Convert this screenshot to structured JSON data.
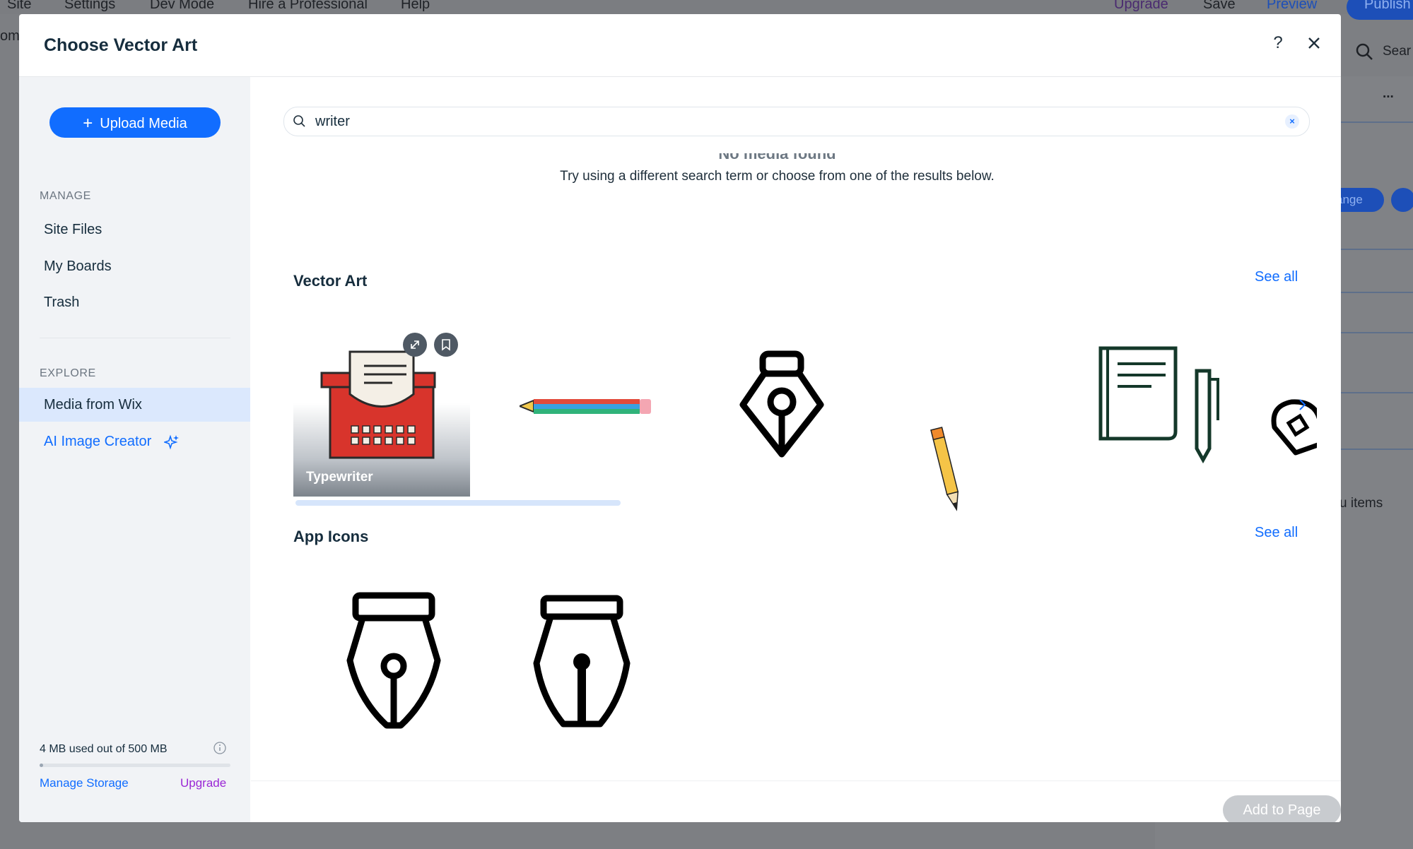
{
  "editor": {
    "menu": [
      "Site",
      "Settings",
      "Dev Mode",
      "Hire a Professional",
      "Help"
    ],
    "upgrade": "Upgrade",
    "save": "Save",
    "preview": "Preview",
    "publish": "Publish",
    "search_label": "Sear",
    "left_fragment": "om",
    "more": "...",
    "pill_fragment": "ange",
    "items_fragment": "u items"
  },
  "dialog": {
    "title": "Choose Vector Art",
    "help_label": "?",
    "add_to_page": "Add to Page"
  },
  "sidebar": {
    "upload_plus": "+",
    "upload_label": "Upload Media",
    "manage_heading": "MANAGE",
    "manage_items": [
      "Site Files",
      "My Boards",
      "Trash"
    ],
    "explore_heading": "EXPLORE",
    "explore_items": [
      "Media from Wix",
      "AI Image Creator"
    ],
    "active_item": "Media from Wix",
    "storage_text": "4 MB used out of 500 MB",
    "storage_used_fraction": 0.008,
    "manage_storage": "Manage Storage",
    "upgrade": "Upgrade"
  },
  "search": {
    "value": "writer",
    "placeholder": "",
    "clear_label": "×"
  },
  "results": {
    "no_results_partial": "No media found",
    "hint": "Try using a different search term or choose from one of the results below.",
    "sections": [
      {
        "title": "Vector Art",
        "see_all": "See all",
        "items": [
          "typewriter-icon",
          "crayon-icon",
          "pen-nib-icon",
          "pencil-icon",
          "notebook-pen-icon",
          "pen-tool-icon"
        ],
        "hovered_item_label": "Typewriter"
      },
      {
        "title": "App Icons",
        "see_all": "See all",
        "items": [
          "fountain-pen-nib-icon",
          "fountain-pen-nib-alt-icon"
        ]
      }
    ]
  },
  "colors": {
    "accent": "#116dff",
    "upgrade": "#9a27d5",
    "sidebar_bg": "#f1f3f6",
    "active_bg": "#dbe8fd",
    "disabled_button": "#c8cbcf"
  }
}
